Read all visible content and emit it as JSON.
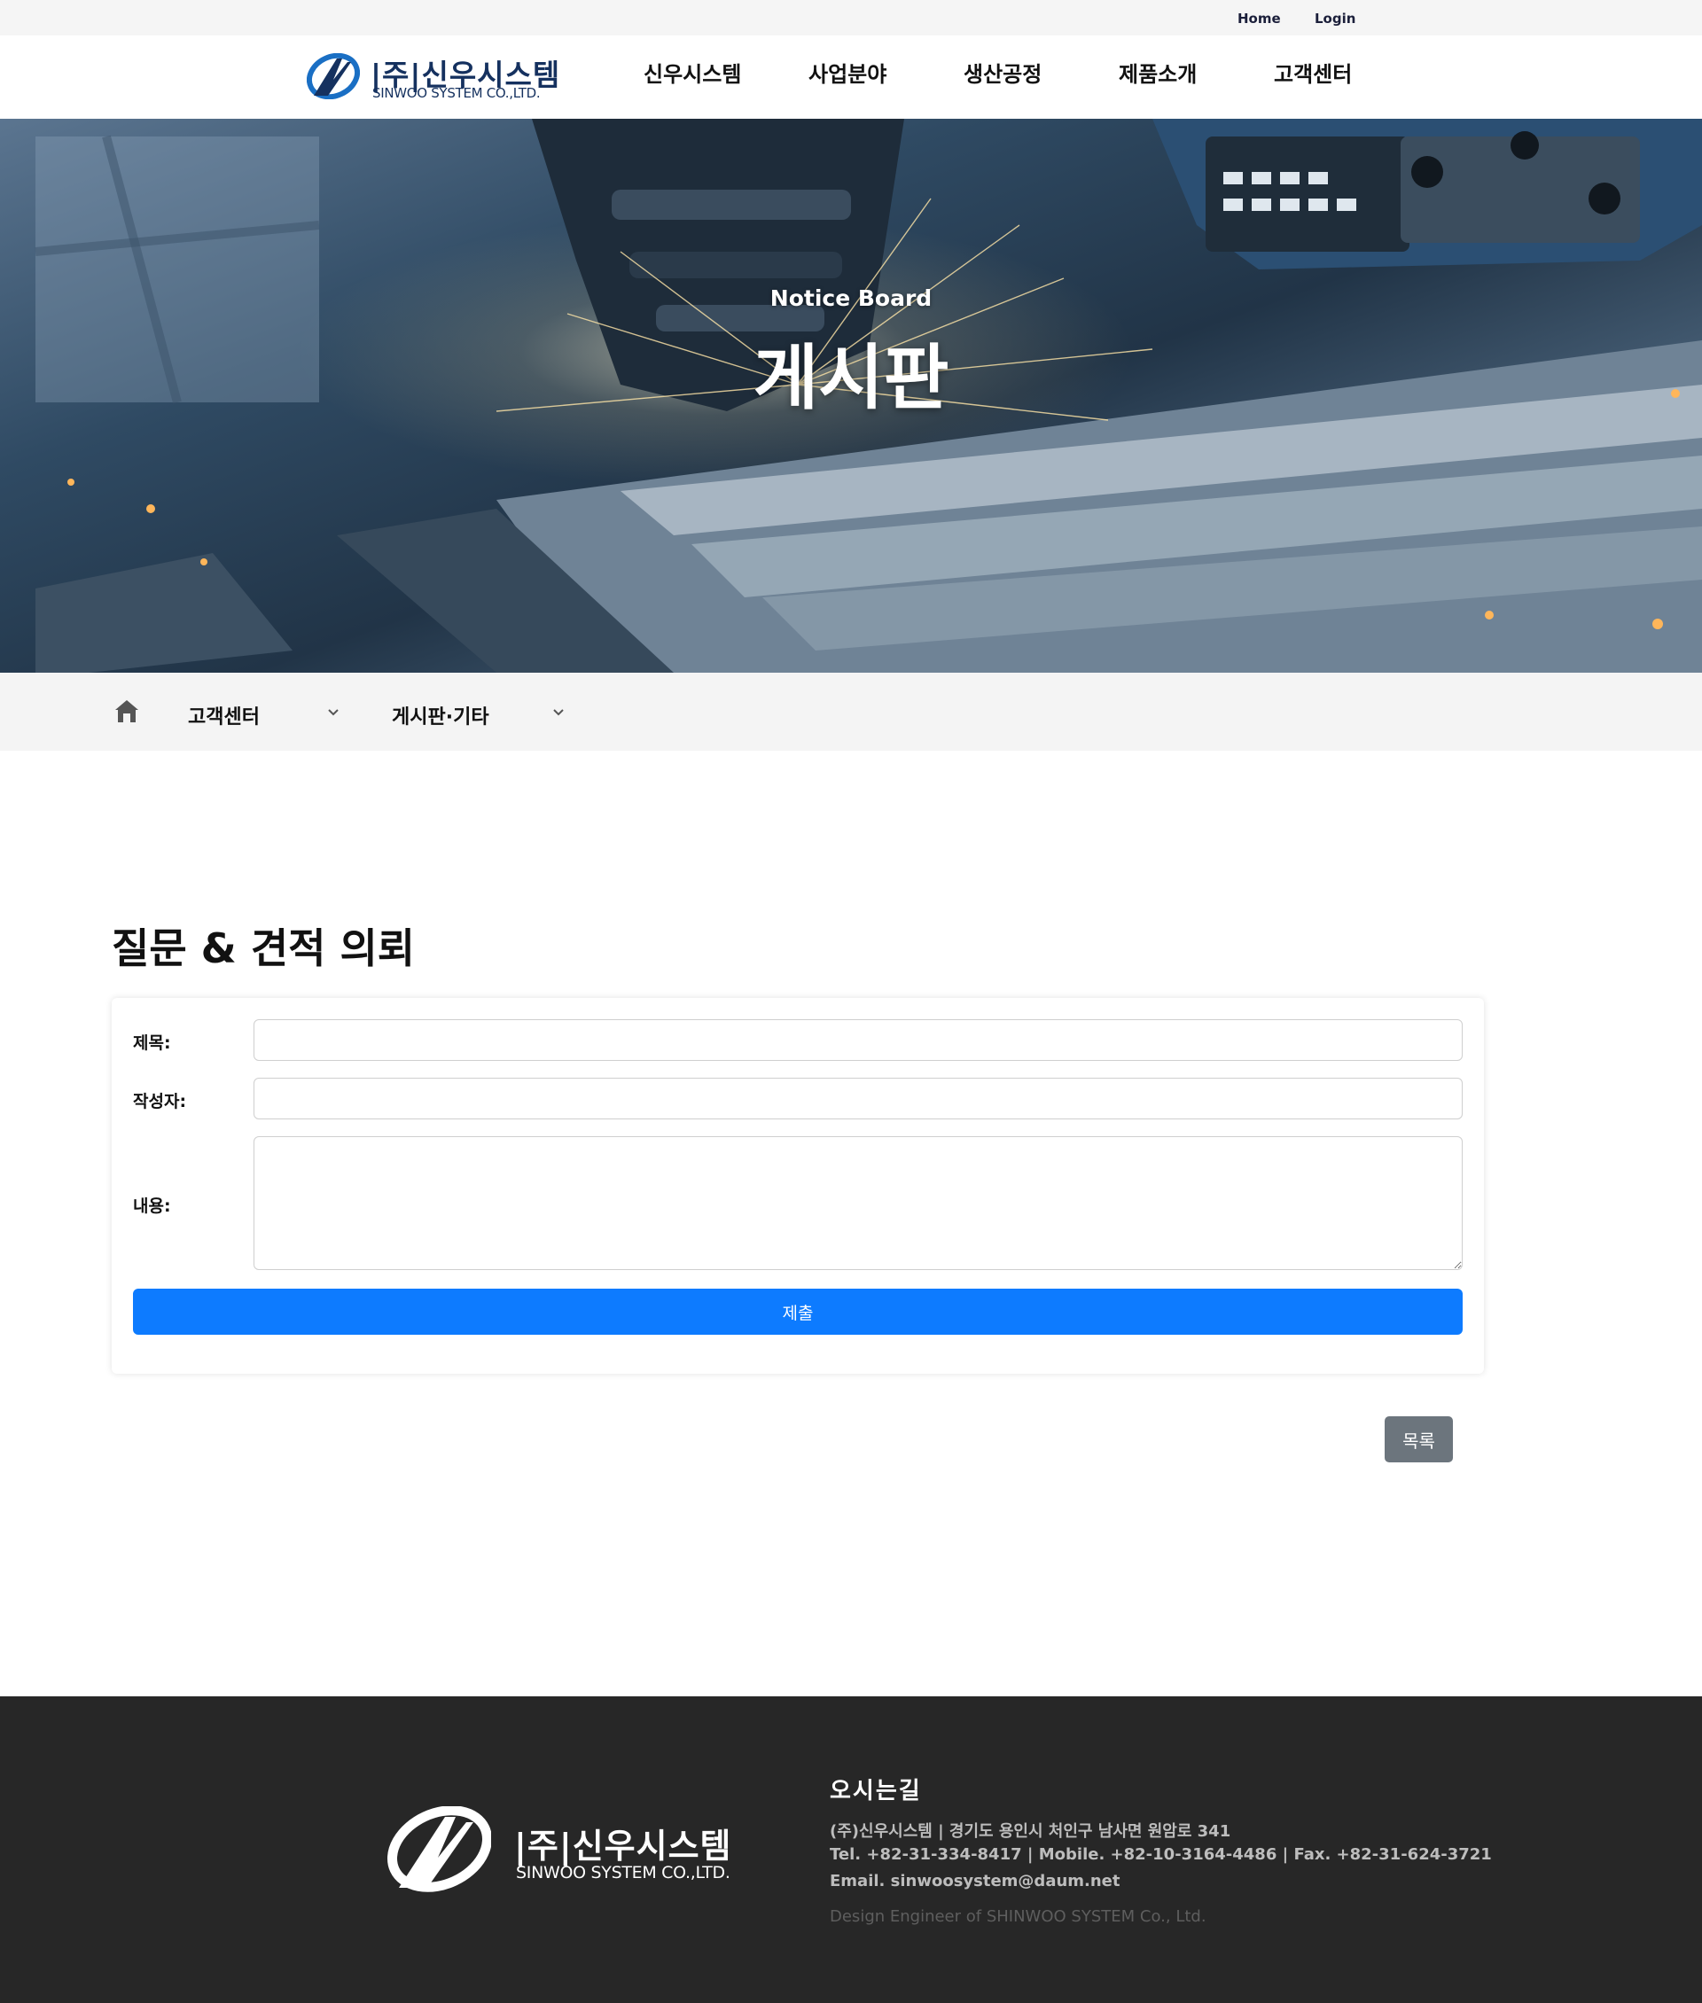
{
  "topbar": {
    "home": "Home",
    "login": "Login"
  },
  "logo": {
    "ko": "|주|신우시스템",
    "en": "SINWOO SYSTEM CO.,LTD."
  },
  "nav": [
    {
      "label": "신우시스템"
    },
    {
      "label": "사업분야"
    },
    {
      "label": "생산공정"
    },
    {
      "label": "제품소개"
    },
    {
      "label": "고객센터"
    }
  ],
  "hero": {
    "subtitle": "Notice Board",
    "title": "게시판"
  },
  "breadcrumb": {
    "level1": "고객센터",
    "level2": "게시판·기타"
  },
  "page": {
    "title": "질문 & 견적 의뢰"
  },
  "form": {
    "title_label": "제목:",
    "title_value": "",
    "author_label": "작성자:",
    "author_value": "",
    "content_label": "내용:",
    "content_value": "",
    "submit_label": "제출"
  },
  "list_button": "목록",
  "footer": {
    "logo_ko": "|주|신우시스템",
    "logo_en": "SINWOO SYSTEM CO.,LTD.",
    "heading": "오시는길",
    "address": "(주)신우시스템   |   경기도 용인시 처인구 남사면 원암로 341",
    "phones": "Tel. +82-31-334-8417   |   Mobile. +82-10-3164-4486   |   Fax. +82-31-624-3721",
    "email": "Email. sinwoosystem@daum.net",
    "copyright": "Design Engineer of SHINWOO SYSTEM Co., Ltd."
  },
  "colors": {
    "brand_navy": "#15315f",
    "brand_blue": "#1a6fc4",
    "submit": "#0d7bff",
    "list_button": "#6c757d",
    "footer_bg": "#272727"
  },
  "icons": [
    "logo-mark-icon",
    "home-icon",
    "chevron-down-icon"
  ]
}
